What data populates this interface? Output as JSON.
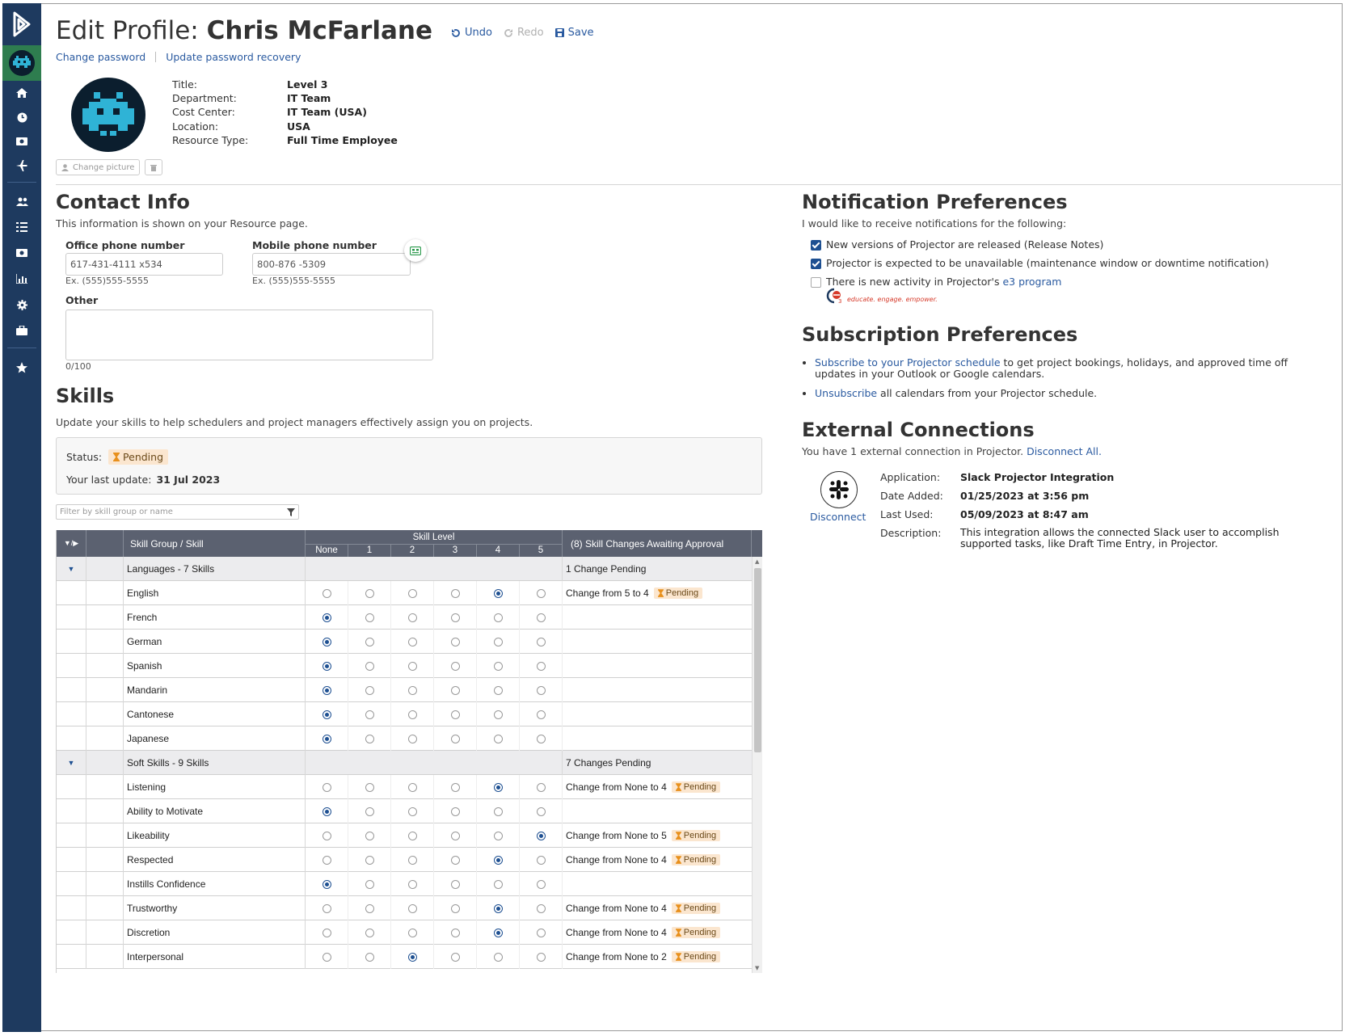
{
  "sidebar": {
    "logo_icon": "projector-logo-icon",
    "nav_icons": [
      "home-icon",
      "clock-icon",
      "money-icon",
      "plane-icon",
      "users-icon",
      "list-icon",
      "money-icon",
      "chart-icon",
      "gear-icon",
      "briefcase-icon",
      "star-icon"
    ]
  },
  "header": {
    "title_prefix": "Edit Profile: ",
    "title_name": "Chris McFarlane",
    "undo": "Undo",
    "redo": "Redo",
    "save": "Save",
    "change_password": "Change password",
    "update_recovery": "Update password recovery"
  },
  "profile": {
    "labels": [
      "Title:",
      "Department:",
      "Cost Center:",
      "Location:",
      "Resource Type:"
    ],
    "values": [
      "Level 3",
      "IT Team",
      "IT Team (USA)",
      "USA",
      "Full Time Employee"
    ],
    "change_picture": "Change picture"
  },
  "contact": {
    "title": "Contact Info",
    "desc": "This information is shown on your Resource page.",
    "office_label": "Office phone number",
    "office_value": "617-431-4111  x534",
    "office_hint": "Ex. (555)555-5555",
    "mobile_label": "Mobile phone number",
    "mobile_value": "800-876 -5309",
    "mobile_hint": "Ex. (555)555-5555",
    "other_label": "Other",
    "other_count": "0/100"
  },
  "skills": {
    "title": "Skills",
    "desc": "Update your skills to help schedulers and project managers effectively assign you on projects.",
    "status_label": "Status:",
    "status_value": "Pending",
    "last_update_label": "Your last update:",
    "last_update_value": "31 Jul 2023",
    "filter_placeholder": "Filter by skill group or name",
    "col_group": "Skill Group / Skill",
    "col_level": "Skill Level",
    "levels": [
      "None",
      "1",
      "2",
      "3",
      "4",
      "5"
    ],
    "col_changes": "(8) Skill Changes Awaiting Approval",
    "rows": [
      {
        "type": "group",
        "name": "Languages - 7 Skills",
        "note": "1 Change Pending"
      },
      {
        "type": "skill",
        "name": "English",
        "level": 4,
        "note": "Change from 5 to 4",
        "pending": true
      },
      {
        "type": "skill",
        "name": "French",
        "level": 0,
        "note": "",
        "pending": false
      },
      {
        "type": "skill",
        "name": "German",
        "level": 0,
        "note": "",
        "pending": false
      },
      {
        "type": "skill",
        "name": "Spanish",
        "level": 0,
        "note": "",
        "pending": false
      },
      {
        "type": "skill",
        "name": "Mandarin",
        "level": 0,
        "note": "",
        "pending": false
      },
      {
        "type": "skill",
        "name": "Cantonese",
        "level": 0,
        "note": "",
        "pending": false
      },
      {
        "type": "skill",
        "name": "Japanese",
        "level": 0,
        "note": "",
        "pending": false
      },
      {
        "type": "group",
        "name": "Soft Skills - 9 Skills",
        "note": "7 Changes Pending"
      },
      {
        "type": "skill",
        "name": "Listening",
        "level": 4,
        "note": "Change from None to 4",
        "pending": true
      },
      {
        "type": "skill",
        "name": "Ability to Motivate",
        "level": 0,
        "note": "",
        "pending": false
      },
      {
        "type": "skill",
        "name": "Likeability",
        "level": 5,
        "note": "Change from None to 5",
        "pending": true
      },
      {
        "type": "skill",
        "name": "Respected",
        "level": 4,
        "note": "Change from None to 4",
        "pending": true
      },
      {
        "type": "skill",
        "name": "Instills Confidence",
        "level": 0,
        "note": "",
        "pending": false
      },
      {
        "type": "skill",
        "name": "Trustworthy",
        "level": 4,
        "note": "Change from None to 4",
        "pending": true
      },
      {
        "type": "skill",
        "name": "Discretion",
        "level": 4,
        "note": "Change from None to 4",
        "pending": true
      },
      {
        "type": "skill",
        "name": "Interpersonal",
        "level": 2,
        "note": "Change from None to 2",
        "pending": true
      }
    ],
    "pending_label": "Pending"
  },
  "notifications": {
    "title": "Notification Preferences",
    "desc": "I would like to receive notifications for the following:",
    "opt1": "New versions of Projector are released (Release Notes)",
    "opt2": "Projector is expected to be unavailable (maintenance window or downtime notification)",
    "opt3_prefix": "There is new activity in Projector's ",
    "opt3_link": "e3 program",
    "e3_tagline": "educate. engage. empower."
  },
  "subscription": {
    "title": "Subscription Preferences",
    "b1_link": "Subscribe to your Projector schedule",
    "b1_rest": " to get project bookings, holidays, and approved time off updates in your Outlook or Google calendars.",
    "b2_link": "Unsubscribe",
    "b2_rest": " all calendars from your Projector schedule."
  },
  "external": {
    "title": "External Connections",
    "desc_prefix": "You have 1 external connection in Projector. ",
    "disconnect_all": "Disconnect All.",
    "disconnect": "Disconnect",
    "labels": [
      "Application:",
      "Date Added:",
      "Last Used:",
      "Description:"
    ],
    "application": "Slack Projector Integration",
    "date_added": "01/25/2023 at 3:56 pm",
    "last_used": "05/09/2023 at 8:47 am",
    "description": "This integration allows the connected Slack user to accomplish supported tasks, like Draft Time Entry, in Projector."
  }
}
